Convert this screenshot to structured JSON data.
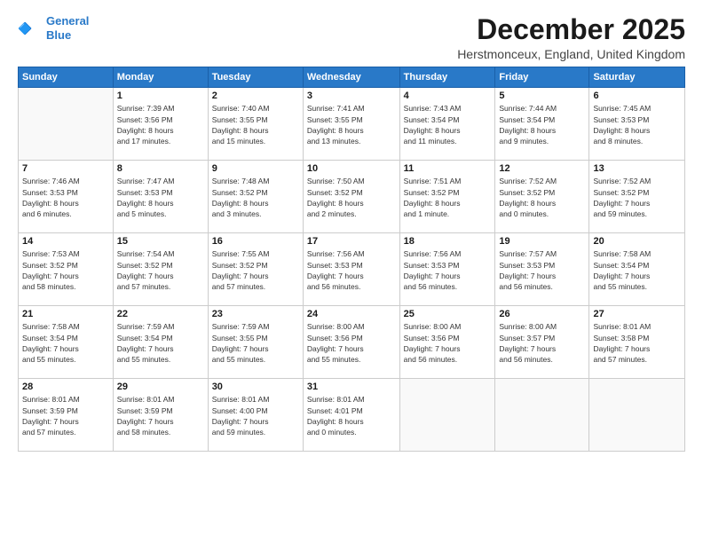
{
  "logo": {
    "line1": "General",
    "line2": "Blue",
    "icon": "🔷"
  },
  "title": "December 2025",
  "subtitle": "Herstmonceux, England, United Kingdom",
  "days_of_week": [
    "Sunday",
    "Monday",
    "Tuesday",
    "Wednesday",
    "Thursday",
    "Friday",
    "Saturday"
  ],
  "weeks": [
    [
      {
        "day": "",
        "sunrise": "",
        "sunset": "",
        "daylight": ""
      },
      {
        "day": "1",
        "sunrise": "Sunrise: 7:39 AM",
        "sunset": "Sunset: 3:56 PM",
        "daylight": "Daylight: 8 hours and 17 minutes."
      },
      {
        "day": "2",
        "sunrise": "Sunrise: 7:40 AM",
        "sunset": "Sunset: 3:55 PM",
        "daylight": "Daylight: 8 hours and 15 minutes."
      },
      {
        "day": "3",
        "sunrise": "Sunrise: 7:41 AM",
        "sunset": "Sunset: 3:55 PM",
        "daylight": "Daylight: 8 hours and 13 minutes."
      },
      {
        "day": "4",
        "sunrise": "Sunrise: 7:43 AM",
        "sunset": "Sunset: 3:54 PM",
        "daylight": "Daylight: 8 hours and 11 minutes."
      },
      {
        "day": "5",
        "sunrise": "Sunrise: 7:44 AM",
        "sunset": "Sunset: 3:54 PM",
        "daylight": "Daylight: 8 hours and 9 minutes."
      },
      {
        "day": "6",
        "sunrise": "Sunrise: 7:45 AM",
        "sunset": "Sunset: 3:53 PM",
        "daylight": "Daylight: 8 hours and 8 minutes."
      }
    ],
    [
      {
        "day": "7",
        "sunrise": "Sunrise: 7:46 AM",
        "sunset": "Sunset: 3:53 PM",
        "daylight": "Daylight: 8 hours and 6 minutes."
      },
      {
        "day": "8",
        "sunrise": "Sunrise: 7:47 AM",
        "sunset": "Sunset: 3:53 PM",
        "daylight": "Daylight: 8 hours and 5 minutes."
      },
      {
        "day": "9",
        "sunrise": "Sunrise: 7:48 AM",
        "sunset": "Sunset: 3:52 PM",
        "daylight": "Daylight: 8 hours and 3 minutes."
      },
      {
        "day": "10",
        "sunrise": "Sunrise: 7:50 AM",
        "sunset": "Sunset: 3:52 PM",
        "daylight": "Daylight: 8 hours and 2 minutes."
      },
      {
        "day": "11",
        "sunrise": "Sunrise: 7:51 AM",
        "sunset": "Sunset: 3:52 PM",
        "daylight": "Daylight: 8 hours and 1 minute."
      },
      {
        "day": "12",
        "sunrise": "Sunrise: 7:52 AM",
        "sunset": "Sunset: 3:52 PM",
        "daylight": "Daylight: 8 hours and 0 minutes."
      },
      {
        "day": "13",
        "sunrise": "Sunrise: 7:52 AM",
        "sunset": "Sunset: 3:52 PM",
        "daylight": "Daylight: 7 hours and 59 minutes."
      }
    ],
    [
      {
        "day": "14",
        "sunrise": "Sunrise: 7:53 AM",
        "sunset": "Sunset: 3:52 PM",
        "daylight": "Daylight: 7 hours and 58 minutes."
      },
      {
        "day": "15",
        "sunrise": "Sunrise: 7:54 AM",
        "sunset": "Sunset: 3:52 PM",
        "daylight": "Daylight: 7 hours and 57 minutes."
      },
      {
        "day": "16",
        "sunrise": "Sunrise: 7:55 AM",
        "sunset": "Sunset: 3:52 PM",
        "daylight": "Daylight: 7 hours and 57 minutes."
      },
      {
        "day": "17",
        "sunrise": "Sunrise: 7:56 AM",
        "sunset": "Sunset: 3:53 PM",
        "daylight": "Daylight: 7 hours and 56 minutes."
      },
      {
        "day": "18",
        "sunrise": "Sunrise: 7:56 AM",
        "sunset": "Sunset: 3:53 PM",
        "daylight": "Daylight: 7 hours and 56 minutes."
      },
      {
        "day": "19",
        "sunrise": "Sunrise: 7:57 AM",
        "sunset": "Sunset: 3:53 PM",
        "daylight": "Daylight: 7 hours and 56 minutes."
      },
      {
        "day": "20",
        "sunrise": "Sunrise: 7:58 AM",
        "sunset": "Sunset: 3:54 PM",
        "daylight": "Daylight: 7 hours and 55 minutes."
      }
    ],
    [
      {
        "day": "21",
        "sunrise": "Sunrise: 7:58 AM",
        "sunset": "Sunset: 3:54 PM",
        "daylight": "Daylight: 7 hours and 55 minutes."
      },
      {
        "day": "22",
        "sunrise": "Sunrise: 7:59 AM",
        "sunset": "Sunset: 3:54 PM",
        "daylight": "Daylight: 7 hours and 55 minutes."
      },
      {
        "day": "23",
        "sunrise": "Sunrise: 7:59 AM",
        "sunset": "Sunset: 3:55 PM",
        "daylight": "Daylight: 7 hours and 55 minutes."
      },
      {
        "day": "24",
        "sunrise": "Sunrise: 8:00 AM",
        "sunset": "Sunset: 3:56 PM",
        "daylight": "Daylight: 7 hours and 55 minutes."
      },
      {
        "day": "25",
        "sunrise": "Sunrise: 8:00 AM",
        "sunset": "Sunset: 3:56 PM",
        "daylight": "Daylight: 7 hours and 56 minutes."
      },
      {
        "day": "26",
        "sunrise": "Sunrise: 8:00 AM",
        "sunset": "Sunset: 3:57 PM",
        "daylight": "Daylight: 7 hours and 56 minutes."
      },
      {
        "day": "27",
        "sunrise": "Sunrise: 8:01 AM",
        "sunset": "Sunset: 3:58 PM",
        "daylight": "Daylight: 7 hours and 57 minutes."
      }
    ],
    [
      {
        "day": "28",
        "sunrise": "Sunrise: 8:01 AM",
        "sunset": "Sunset: 3:59 PM",
        "daylight": "Daylight: 7 hours and 57 minutes."
      },
      {
        "day": "29",
        "sunrise": "Sunrise: 8:01 AM",
        "sunset": "Sunset: 3:59 PM",
        "daylight": "Daylight: 7 hours and 58 minutes."
      },
      {
        "day": "30",
        "sunrise": "Sunrise: 8:01 AM",
        "sunset": "Sunset: 4:00 PM",
        "daylight": "Daylight: 7 hours and 59 minutes."
      },
      {
        "day": "31",
        "sunrise": "Sunrise: 8:01 AM",
        "sunset": "Sunset: 4:01 PM",
        "daylight": "Daylight: 8 hours and 0 minutes."
      },
      {
        "day": "",
        "sunrise": "",
        "sunset": "",
        "daylight": ""
      },
      {
        "day": "",
        "sunrise": "",
        "sunset": "",
        "daylight": ""
      },
      {
        "day": "",
        "sunrise": "",
        "sunset": "",
        "daylight": ""
      }
    ]
  ]
}
